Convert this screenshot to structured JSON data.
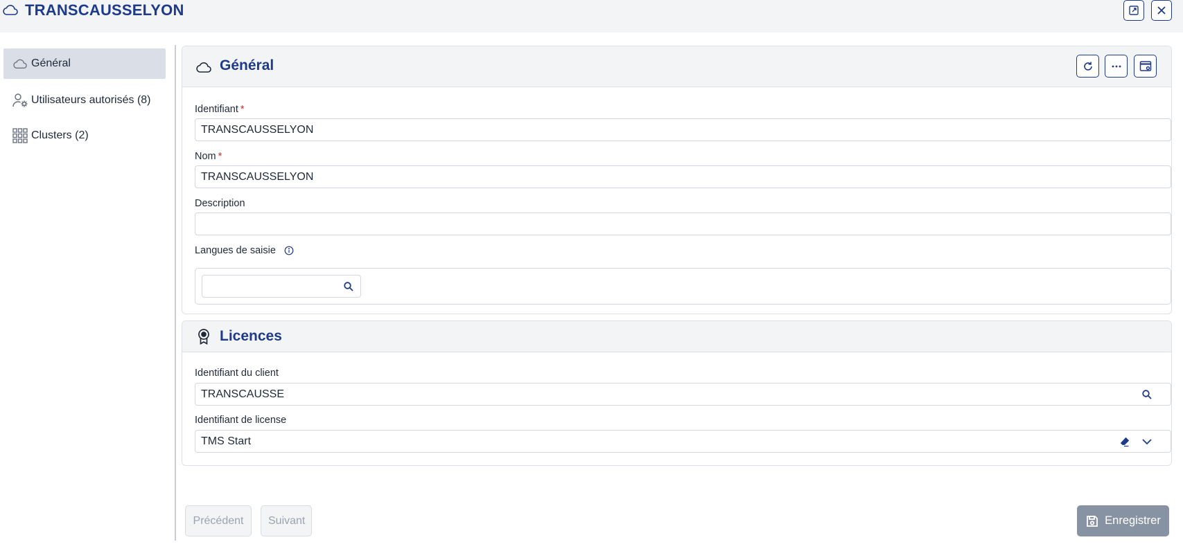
{
  "window": {
    "title": "TRANSCAUSSELYON"
  },
  "sidebar": {
    "items": [
      {
        "label": "Général",
        "active": true
      },
      {
        "label": "Utilisateurs autorisés (8)"
      },
      {
        "label": "Clusters (2)"
      }
    ]
  },
  "general": {
    "title": "Général",
    "fields": {
      "identifiant": {
        "label": "Identifiant",
        "required_mark": "*",
        "value": "TRANSCAUSSELYON"
      },
      "nom": {
        "label": "Nom",
        "required_mark": "*",
        "value": "TRANSCAUSSELYON"
      },
      "description": {
        "label": "Description",
        "value": ""
      },
      "langues": {
        "label": "Langues de saisie",
        "search_value": ""
      }
    }
  },
  "licences": {
    "title": "Licences",
    "fields": {
      "client": {
        "label": "Identifiant du client",
        "value": "TRANSCAUSSE"
      },
      "license": {
        "label": "Identifiant de license",
        "value": "TMS Start"
      }
    }
  },
  "footer": {
    "previous_label": "Précédent",
    "next_label": "Suivant",
    "save_label": "Enregistrer"
  },
  "colors": {
    "accent": "#1e3a8a",
    "required": "#dc2626",
    "save_bg": "#8792a3"
  }
}
